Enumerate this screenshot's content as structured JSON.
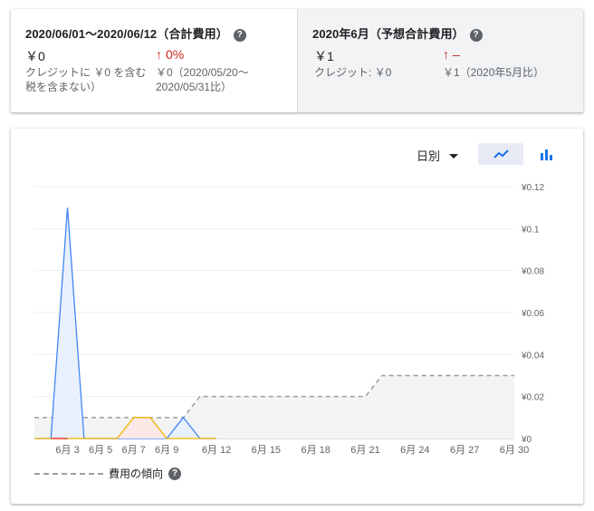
{
  "summary": {
    "current": {
      "title": "2020/06/01～2020/06/12（合計費用）",
      "value": "￥0",
      "change_arrow": "↑",
      "change_value": "0%",
      "credit_line1": "クレジットに ￥0 を含む",
      "credit_line2": "税を含まない）",
      "compare_line1": "￥0（2020/05/20～",
      "compare_line2": "2020/05/31比）"
    },
    "forecast": {
      "title": "2020年6月（予想合計費用）",
      "value": "￥1",
      "change_arrow": "↑",
      "change_value": "–",
      "credit": "クレジット: ￥0",
      "compare": "￥1（2020年5月比）"
    },
    "help_icon": "?"
  },
  "controls": {
    "granularity": "日別",
    "line_chart_icon": "line-chart-icon",
    "bar_chart_icon": "bar-chart-icon"
  },
  "legend": {
    "trend_label": "費用の傾向"
  },
  "colors": {
    "accent": "#1a73e8",
    "line_blue": "#4285f4",
    "area_blue": "#e8f0fe",
    "line_orange": "#f4b400",
    "area_orange": "#fce8e6",
    "trend_gray": "#9aa0a6",
    "negative_red": "#c5221f"
  },
  "chart_data": {
    "type": "area",
    "x_tick_labels": [
      "6月 3",
      "6月 5",
      "6月 7",
      "6月 9",
      "6月 12",
      "6月 15",
      "6月 18",
      "6月 21",
      "6月 24",
      "6月 27",
      "6月 30"
    ],
    "y_tick_labels": [
      "¥0.12",
      "¥0.1",
      "¥0.08",
      "¥0.06",
      "¥0.04",
      "¥0.02",
      "¥0"
    ],
    "ylim": [
      0,
      0.12
    ],
    "xlim": [
      1,
      30
    ],
    "series": [
      {
        "color": "#4285f4",
        "x": [
          1,
          2,
          3,
          4,
          5,
          6,
          7,
          8,
          9,
          10,
          11,
          12
        ],
        "y": [
          0,
          0,
          0.11,
          0,
          0,
          0,
          0,
          0,
          0,
          0.01,
          0,
          0
        ]
      },
      {
        "color": "#f4b400",
        "x": [
          1,
          2,
          3,
          4,
          5,
          6,
          7,
          8,
          9,
          10,
          11,
          12
        ],
        "y": [
          0,
          0,
          0,
          0,
          0,
          0,
          0.01,
          0.01,
          0,
          0,
          0,
          0
        ]
      }
    ],
    "trend": {
      "x": [
        1,
        2,
        10,
        11,
        21,
        22,
        30
      ],
      "y": [
        0.01,
        0.01,
        0.01,
        0.02,
        0.02,
        0.03,
        0.03
      ]
    },
    "grid": true
  }
}
